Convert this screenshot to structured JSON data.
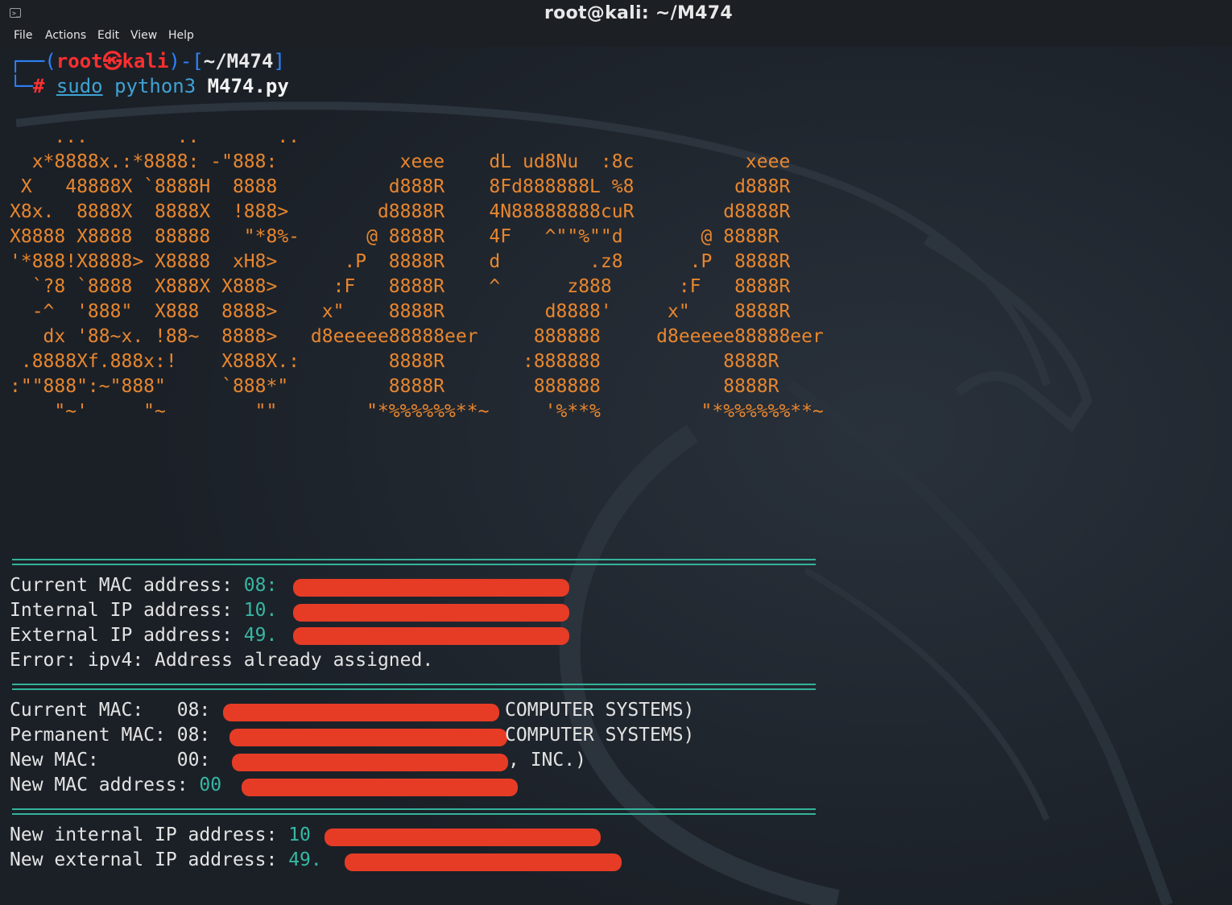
{
  "window": {
    "title": "root@kali: ~/M474",
    "icon": "terminal-icon"
  },
  "menu": [
    "File",
    "Actions",
    "Edit",
    "View",
    "Help"
  ],
  "prompt": {
    "open": "┌──(",
    "user": "root",
    "sep": "㉿",
    "host": "kali",
    "mid": ")-[",
    "path": "~/M474",
    "close": "]",
    "corner": "└─",
    "hash": "#",
    "cmd_sudo": "sudo",
    "cmd_python": "python3",
    "cmd_file": "M474.py"
  },
  "banner": [
    "    ...        ..       ..",
    "  x*8888x.:*8888: -\"888:           xeee    dL ud8Nu  :8c          xeee",
    " X   48888X `8888H  8888          d888R    8Fd888888L %8         d888R",
    "X8x.  8888X  8888X  !888>        d8888R    4N88888888cuR        d8888R",
    "X8888 X8888  88888   \"*8%-      @ 8888R    4F   ^\"\"%\"\"d       @ 8888R",
    "'*888!X8888> X8888  xH8>      .P  8888R    d        .z8      .P  8888R",
    "  `?8 `8888  X888X X888>     :F   8888R    ^      z888      :F   8888R",
    "  -^  '888\"  X888  8888>    x\"    8888R         d8888'     x\"    8888R",
    "   dx '88~x. !88~  8888>   d8eeeee88888eer     888888     d8eeeee88888eer",
    " .8888Xf.888x:!    X888X.:        8888R       :888888           8888R",
    ":\"\"888\":~\"888\"     `888*\"         8888R        888888           8888R",
    "    \"~'     \"~        \"\"        \"*%%%%%%**~     '%**%         \"*%%%%%%**~"
  ],
  "section1": {
    "mac_label": "Current MAC address: ",
    "mac_value": "08:",
    "int_label": "Internal IP address: ",
    "int_value": "10.",
    "ext_label": "External IP address: ",
    "ext_value": "49.",
    "error": "Error: ipv4: Address already assigned."
  },
  "section2": {
    "cur_label": "Current MAC:   ",
    "cur_value": "08:",
    "cur_vendor": "COMPUTER SYSTEMS)",
    "perm_label": "Permanent MAC: ",
    "perm_value": "08:",
    "perm_vendor": "COMPUTER SYSTEMS)",
    "new_label": "New MAC:       ",
    "new_value": "00:",
    "new_vendor": ", INC.)",
    "newaddr_label": "New MAC address: ",
    "newaddr_value": "00"
  },
  "section3": {
    "int_label": "New internal IP address: ",
    "int_value": "10",
    "ext_label": "New external IP address: ",
    "ext_value": "49."
  },
  "colors": {
    "background": "#1b2027",
    "banner": "#e8862e",
    "accent": "#36b7a3",
    "redaction": "#e63c26",
    "prompt_box": "#2d84ff",
    "prompt_user": "#ff2f2f"
  }
}
